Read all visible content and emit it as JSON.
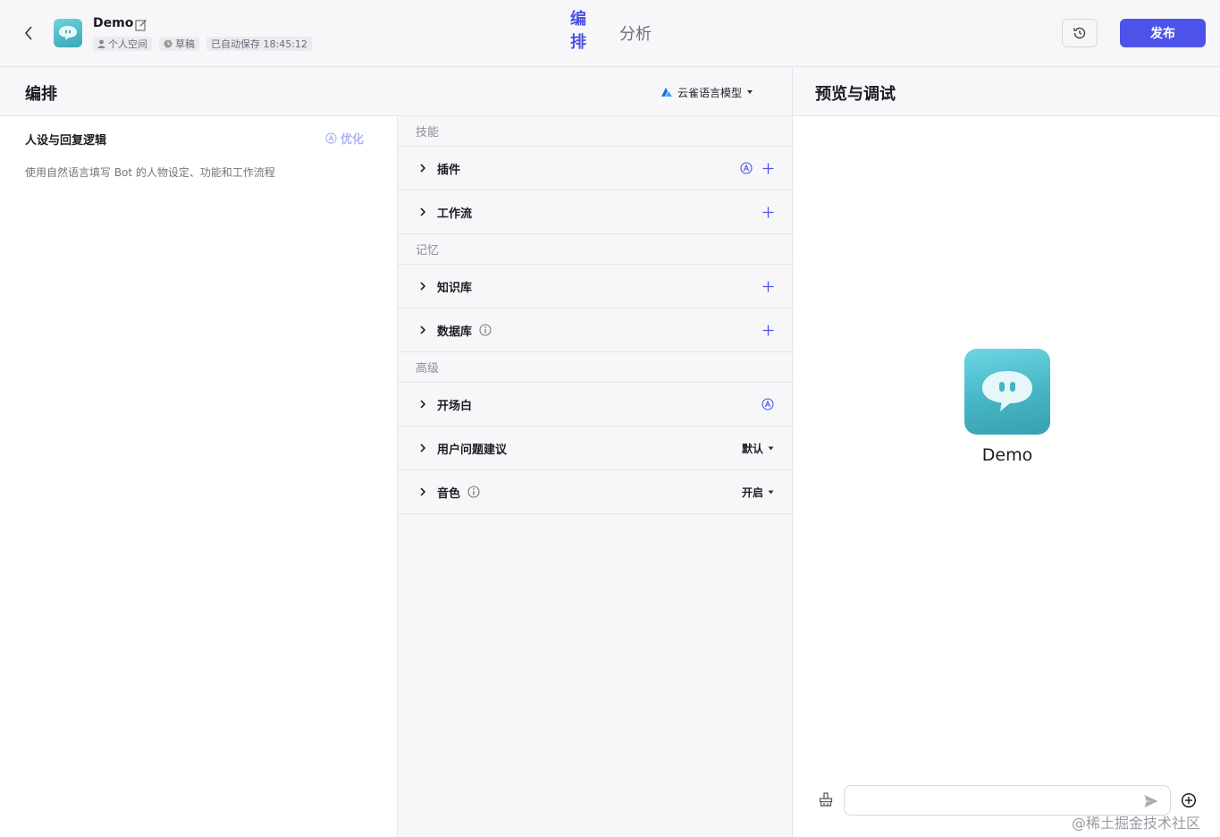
{
  "header": {
    "bot_name": "Demo",
    "chips": {
      "space": "个人空间",
      "status": "草稿",
      "autosave": "已自动保存 18:45:12"
    },
    "tabs": {
      "edit": "编排",
      "analysis": "分析"
    },
    "publish_label": "发布"
  },
  "left_panel": {
    "title": "编排",
    "model": "云雀语言模型"
  },
  "persona": {
    "title": "人设与回复逻辑",
    "optimize_label": "优化",
    "placeholder": "使用自然语言填写 Bot 的人物设定、功能和工作流程"
  },
  "skills": {
    "group_skill": "技能",
    "plugin": "插件",
    "workflow": "工作流",
    "group_memory": "记忆",
    "knowledge": "知识库",
    "database": "数据库",
    "group_advanced": "高级",
    "opening": "开场白",
    "suggestion": "用户问题建议",
    "suggestion_value": "默认",
    "voice": "音色",
    "voice_value": "开启"
  },
  "preview": {
    "title": "预览与调试",
    "bot_name": "Demo",
    "input_value": ""
  },
  "watermark": "@稀土掘金技术社区",
  "colors": {
    "accent": "#4d53e8",
    "bot_gradient": "#45b5c4"
  }
}
